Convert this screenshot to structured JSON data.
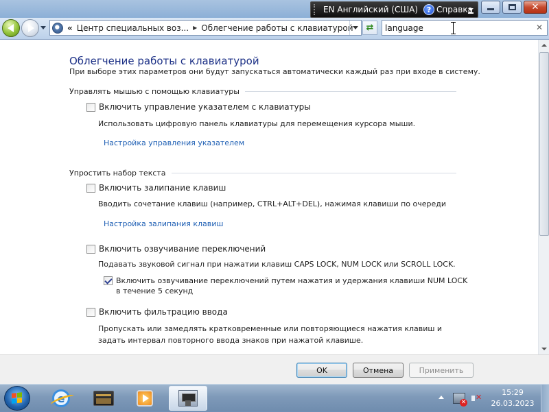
{
  "language_bar": {
    "language": "EN Английский (США)",
    "help": "Справка"
  },
  "navigation": {
    "address": {
      "chevrons": "«",
      "crumbs": [
        "Центр специальных воз...",
        "Облегчение работы с клавиатурой"
      ]
    },
    "search": {
      "value": "language"
    }
  },
  "content": {
    "title": "Облегчение работы с клавиатурой",
    "subtitle": "При выборе этих параметров они будут запускаться автоматически каждый раз при входе в систему.",
    "groups": [
      {
        "heading": "Управлять мышью с помощью клавиатуры",
        "items": [
          {
            "label": "Включить управление указателем с клавиатуры",
            "checked": false,
            "description": "Использовать цифровую панель клавиатуры для перемещения курсора мыши.",
            "link": "Настройка управления указателем"
          }
        ]
      },
      {
        "heading": "Упростить набор текста",
        "items": [
          {
            "label": "Включить залипание клавиш",
            "checked": false,
            "description": "Вводить сочетание клавиш (например, CTRL+ALT+DEL), нажимая клавиши по очереди",
            "link": "Настройка залипания клавиш"
          },
          {
            "label": "Включить озвучивание переключений",
            "checked": false,
            "description": "Подавать звуковой сигнал при нажатии клавиш CAPS LOCK, NUM LOCK или SCROLL LOCK.",
            "sub_option": {
              "label": "Включить озвучивание переключений путем нажатия и удержания клавиши NUM LOCK в течение 5 секунд",
              "checked": true
            }
          },
          {
            "label": "Включить фильтрацию ввода",
            "checked": false,
            "description": "Пропускать или замедлять кратковременные или повторяющиеся нажатия клавиш и задать интервал повторного ввода знаков при нажатой клавише."
          }
        ]
      }
    ]
  },
  "buttons": {
    "ok": "OK",
    "cancel": "Отмена",
    "apply": "Применить",
    "apply_enabled": false
  },
  "taskbar": {
    "apps": [
      "internet-explorer-icon",
      "file-explorer-icon",
      "media-player-icon",
      "control-panel-icon"
    ],
    "clock": {
      "time": "15:29",
      "date": "26.03.2023"
    }
  },
  "colors": {
    "title": "#1e3287",
    "link": "#1e5fb4",
    "taskbar": "#7f9ab9"
  }
}
